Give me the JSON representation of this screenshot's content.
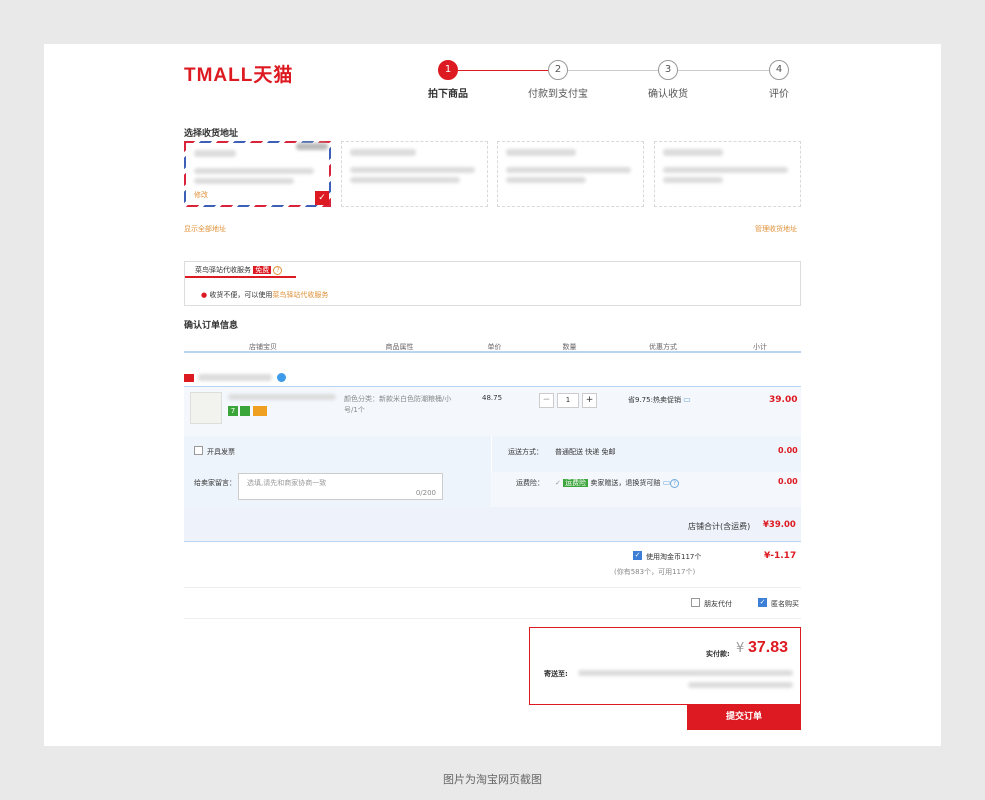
{
  "header": {
    "logo": "TMALL天猫"
  },
  "steps": [
    {
      "num": "1",
      "label": "拍下商品"
    },
    {
      "num": "2",
      "label": "付款到支付宝"
    },
    {
      "num": "3",
      "label": "确认收货"
    },
    {
      "num": "4",
      "label": "评价"
    }
  ],
  "address": {
    "title": "选择收货地址",
    "edit": "修改",
    "show_all": "显示全部地址",
    "manage": "管理收货地址"
  },
  "cainiao": {
    "tab": "菜鸟驿站代收服务",
    "free": "免费",
    "help": "?",
    "tip_prefix": "收货不便，可以使用",
    "tip_link": "菜鸟驿站代收服务"
  },
  "order": {
    "title": "确认订单信息",
    "headers": [
      "店铺宝贝",
      "商品属性",
      "单价",
      "数量",
      "优惠方式",
      "小计"
    ],
    "item": {
      "attr": "颜色分类：新款米白色防潮粮桶/小号/1个",
      "price": "48.75",
      "qty": "1",
      "minus": "−",
      "plus": "+",
      "promo": "省9.75:热卖促销",
      "subtotal": "39.00",
      "badge_seven": "7"
    },
    "invoice": "开具发票",
    "shipping_label": "运送方式：",
    "shipping_value": "普通配送 快递 免邮",
    "shipping_cost": "0.00",
    "message_label": "给卖家留言：",
    "message_placeholder": "选填,请先和商家协商一致",
    "message_count": "0/200",
    "insurance_label": "运费险：",
    "insurance_tag": "运费险",
    "insurance_text": "卖家赠送，退换货可赔",
    "insurance_cost": "0.00",
    "shop_total_label": "店铺合计(含运费)",
    "shop_total": "¥39.00"
  },
  "coins": {
    "label": "使用淘金币117个",
    "amount": "¥-1.17",
    "note": "(你有583个，可用117个)"
  },
  "options": {
    "friend_pay": "朋友代付",
    "anonymous": "匿名购买"
  },
  "pay": {
    "label": "实付款:",
    "currency": "¥",
    "amount": "37.83",
    "ship_to": "寄送至:",
    "submit": "提交订单"
  },
  "caption": "图片为淘宝网页截图",
  "colors": {
    "accent": "#dd1a21",
    "link": "#e0923a",
    "blue_line": "#b7d4f0"
  }
}
